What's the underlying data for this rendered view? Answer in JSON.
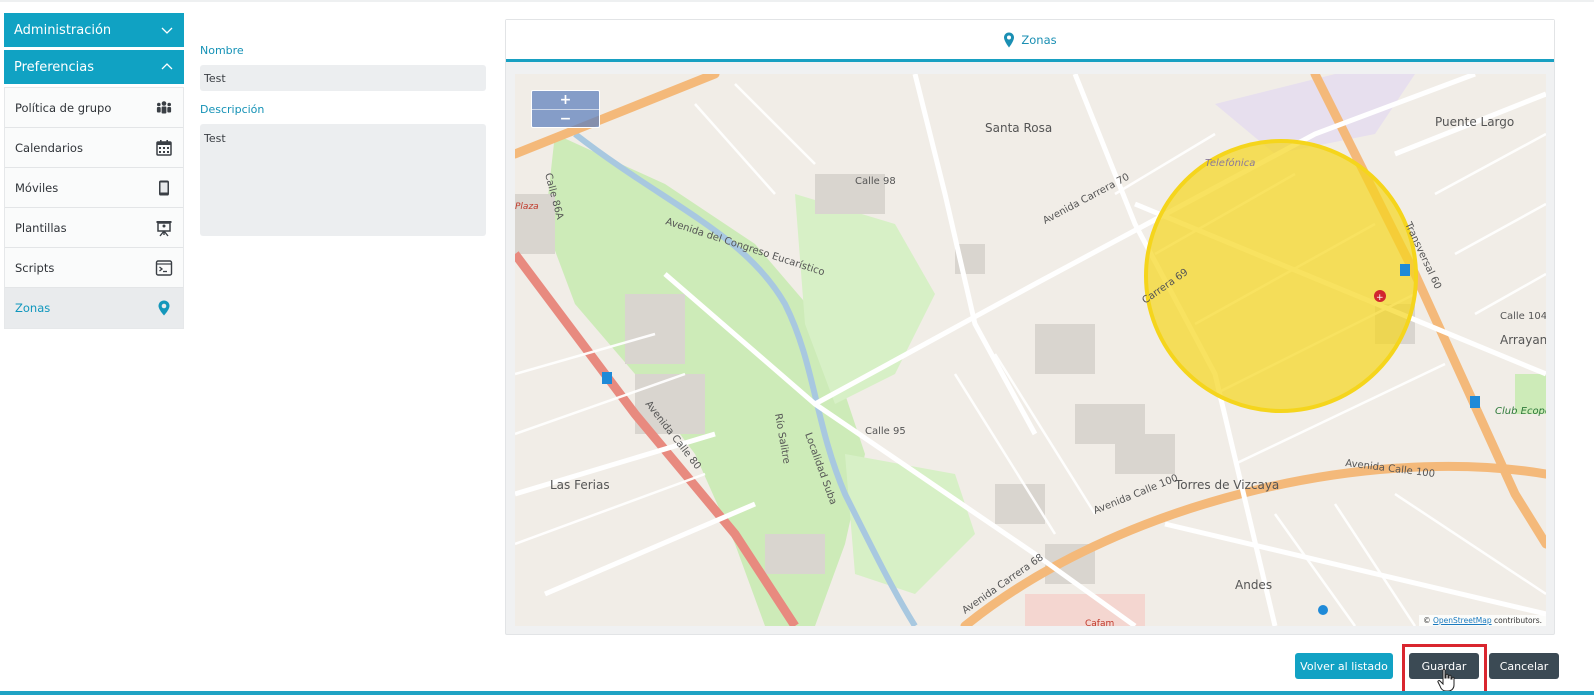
{
  "sidebar": {
    "sections": [
      {
        "label": "Administración",
        "expanded": false
      },
      {
        "label": "Preferencias",
        "expanded": true
      }
    ],
    "items": [
      {
        "label": "Política de grupo",
        "icon": "group-icon"
      },
      {
        "label": "Calendarios",
        "icon": "calendar-icon"
      },
      {
        "label": "Móviles",
        "icon": "mobile-icon"
      },
      {
        "label": "Plantillas",
        "icon": "presentation-icon"
      },
      {
        "label": "Scripts",
        "icon": "terminal-icon"
      },
      {
        "label": "Zonas",
        "icon": "location-pin-icon",
        "active": true
      }
    ]
  },
  "form": {
    "name_label": "Nombre",
    "name_value": "Test",
    "description_label": "Descripción",
    "description_value": "Test"
  },
  "map_panel": {
    "title": "Zonas",
    "zoom_in": "+",
    "zoom_out": "−",
    "attribution_prefix": "©",
    "attribution_link": "OpenStreetMap",
    "attribution_suffix": "contributors.",
    "zone_color": "#f5d51c"
  },
  "map_labels": [
    "Santa Rosa",
    "Puente Largo",
    "Telefónica",
    "Arrayan",
    "Club Ecope",
    "Las Ferias",
    "Torres de Vizcaya",
    "Andes",
    "Avenida Calle 100",
    "Avenida Calle 80",
    "Avenida del Congreso Eucarístico",
    "Avenida Carrera 70",
    "Avenida Carrera 68",
    "Transversal 60",
    "Calle 98",
    "Calle 95",
    "Calle 86A",
    "Carrera 69",
    "Calle 104",
    "Río Salitre",
    "Localidad Suba",
    "Plaza",
    "Cafam"
  ],
  "actions": {
    "back": "Volver al listado",
    "save": "Guardar",
    "cancel": "Cancelar"
  },
  "colors": {
    "accent": "#10a2c3",
    "dark_button": "#3b4a54",
    "highlight": "#d9262f"
  }
}
